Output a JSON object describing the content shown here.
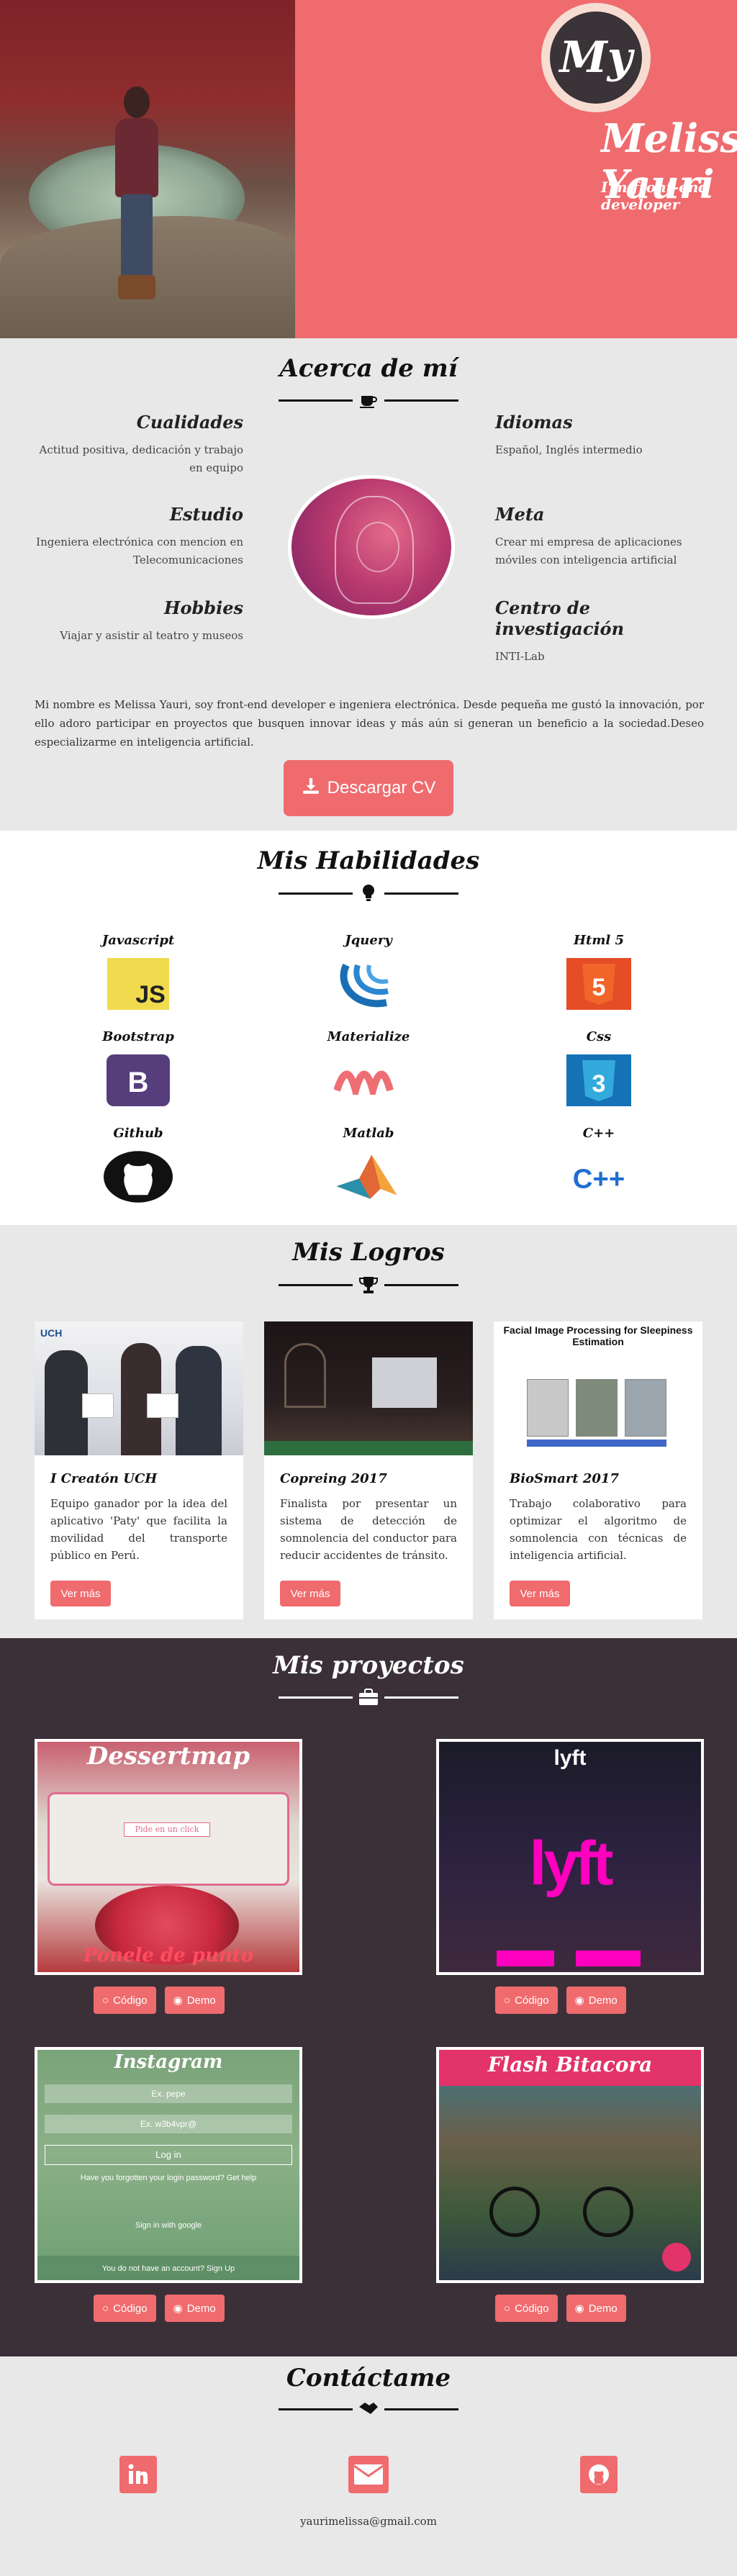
{
  "hero": {
    "logo_text": "My",
    "name": "Melissa Yauri",
    "role": "I'm front-end developer"
  },
  "about": {
    "title": "Acerca de mí",
    "left": [
      {
        "title": "Cualidades",
        "text": "Actitud positiva, dedicación y trabajo en equipo"
      },
      {
        "title": "Estudio",
        "text": "Ingeniera electrónica con mencion en Telecomunicaciones"
      },
      {
        "title": "Hobbies",
        "text": "Viajar y asistir al teatro y museos"
      }
    ],
    "right": [
      {
        "title": "Idiomas",
        "text": "Español, Inglés intermedio"
      },
      {
        "title": "Meta",
        "text": "Crear mi empresa de aplicaciones móviles con inteligencia artificial"
      },
      {
        "title": "Centro de investigación",
        "text": "INTI-Lab"
      }
    ],
    "bio": "Mi nombre es Melissa Yauri, soy front-end developer e ingeniera electrónica. Desde pequeña me gustó la innovación, por ello adoro participar en proyectos que busquen innovar ideas y más aún si generan un beneficio a la sociedad.Deseo especializarme en inteligencia artificial.",
    "cv_button": "Descargar CV"
  },
  "skills": {
    "title": "Mis Habilidades",
    "items": [
      {
        "label": "Javascript",
        "icon": "javascript-logo"
      },
      {
        "label": "Jquery",
        "icon": "jquery-logo"
      },
      {
        "label": "Html 5",
        "icon": "html5-logo"
      },
      {
        "label": "Bootstrap",
        "icon": "bootstrap-logo"
      },
      {
        "label": "Materialize",
        "icon": "materialize-logo"
      },
      {
        "label": "Css",
        "icon": "css3-logo"
      },
      {
        "label": "Github",
        "icon": "github-logo"
      },
      {
        "label": "Matlab",
        "icon": "matlab-logo"
      },
      {
        "label": "C++",
        "icon": "cpp-logo"
      }
    ],
    "badge": {
      "js": "JS",
      "b": "B",
      "cpp": "C++",
      "h5": "5",
      "c3": "3"
    }
  },
  "logros": {
    "title": "Mis Logros",
    "more_label": "Ver más",
    "cards": [
      {
        "title": "I Creatón UCH",
        "text": "Equipo ganador por la idea del aplicativo 'Paty' que facilita la movilidad del transporte público en Perú.",
        "img_text": "UCH"
      },
      {
        "title": "Copreing 2017",
        "text": "Finalista por presentar un sistema de detección de somnolencia del conductor para reducir accidentes de tránsito.",
        "img_text": ""
      },
      {
        "title": "BioSmart 2017",
        "text": "Trabajo colaborativo para optimizar el algoritmo de somnolencia con técnicas de inteligencia artificial.",
        "img_text": "Facial Image Processing for Sleepiness Estimation"
      }
    ]
  },
  "projects": {
    "title": "Mis proyectos",
    "code_label": "Código",
    "demo_label": "Demo",
    "items": [
      {
        "name": "Dessertmap",
        "footer": "Ponele de punto",
        "tagline": "Pide en un click"
      },
      {
        "name": "lyft",
        "footer": "lyft"
      },
      {
        "name": "Instagram",
        "fields": [
          "Ex. pepe",
          "Ex. w3b4vpr@"
        ],
        "login": "Log in",
        "forgot": "Have you forgotten your login password? Get help",
        "google": "Sign in with google",
        "signup": "You do not have an account? Sign Up"
      },
      {
        "name": "Flash Bitacora"
      }
    ]
  },
  "contact": {
    "title": "Contáctame",
    "email": "yaurimelissa@gmail.com",
    "icons": [
      "linkedin-icon",
      "mail-icon",
      "github-icon"
    ]
  },
  "colors": {
    "accent": "#ef6b6e",
    "dark": "#3b3038",
    "light": "#e8e8e8"
  }
}
